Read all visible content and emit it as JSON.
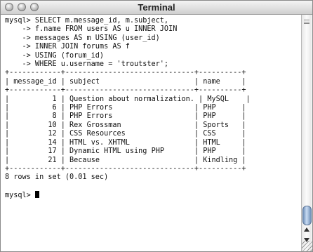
{
  "window": {
    "title": "Terminal"
  },
  "terminal": {
    "query": [
      "mysql> SELECT m.message_id, m.subject,",
      "    -> f.name FROM users AS u INNER JOIN",
      "    -> messages AS m USING (user_id)",
      "    -> INNER JOIN forums AS f",
      "    -> USING (forum_id)",
      "    -> WHERE u.username = 'troutster';"
    ],
    "border": "+------------+------------------------------+----------+",
    "columns": [
      "message_id",
      "subject",
      "name"
    ],
    "rows": [
      {
        "message_id": "1",
        "subject": "Question about normalization.",
        "name": "MySQL"
      },
      {
        "message_id": "6",
        "subject": "PHP Errors",
        "name": "PHP"
      },
      {
        "message_id": "8",
        "subject": "PHP Errors",
        "name": "PHP"
      },
      {
        "message_id": "10",
        "subject": "Rex Grossman",
        "name": "Sports"
      },
      {
        "message_id": "12",
        "subject": "CSS Resources",
        "name": "CSS"
      },
      {
        "message_id": "14",
        "subject": "HTML vs. XHTML",
        "name": "HTML"
      },
      {
        "message_id": "17",
        "subject": "Dynamic HTML using PHP",
        "name": "PHP"
      },
      {
        "message_id": "21",
        "subject": "Because",
        "name": "Kindling"
      }
    ],
    "status": "8 rows in set (0.01 sec)",
    "prompt": "mysql> "
  }
}
